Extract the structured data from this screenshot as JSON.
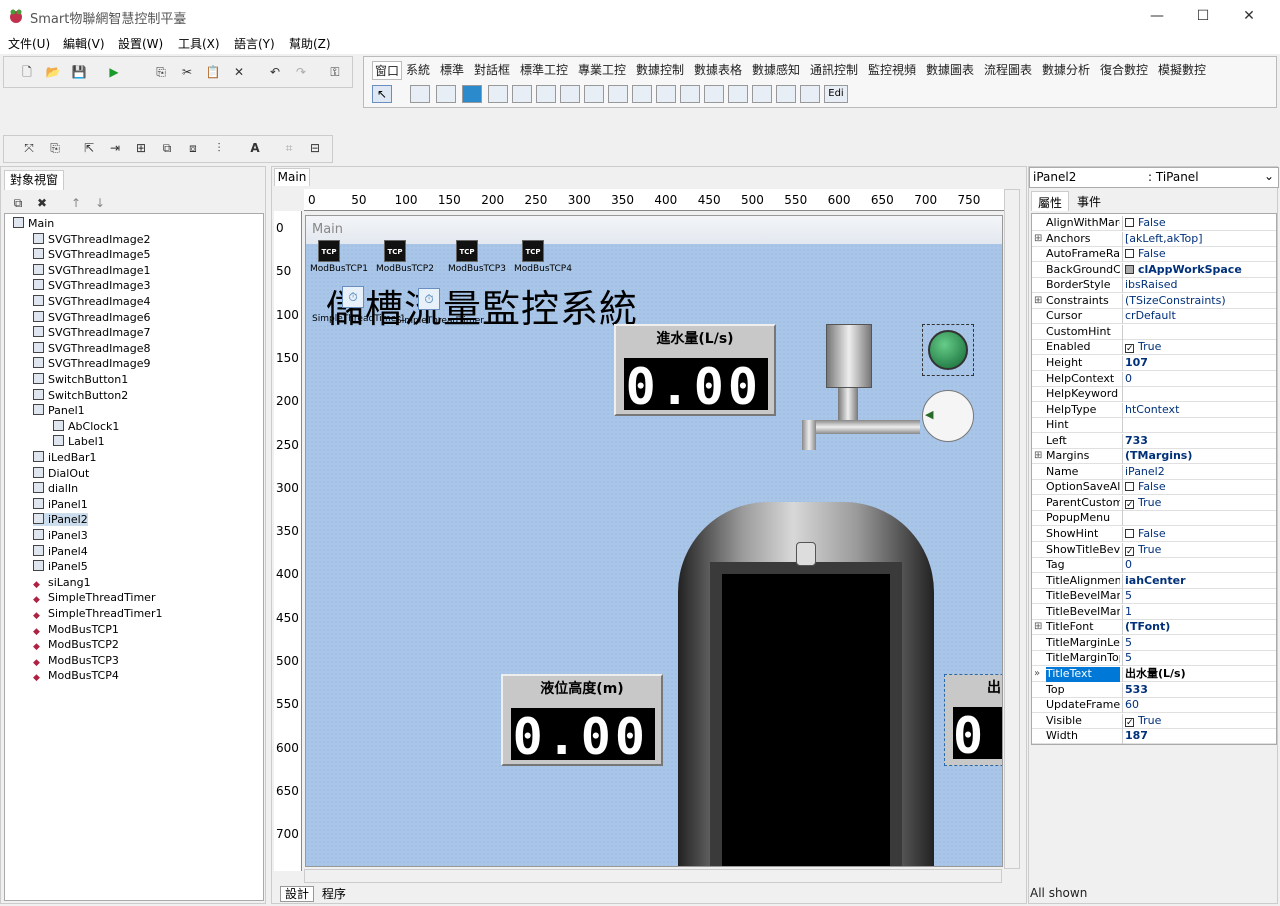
{
  "window": {
    "title": "Smart物聯網智慧控制平臺",
    "min": "—",
    "max": "☐",
    "close": "✕"
  },
  "menu": [
    "文件(U)",
    "編輯(V)",
    "設置(W)",
    "工具(X)",
    "語言(Y)",
    "幫助(Z)"
  ],
  "palette": {
    "tabs": [
      "窗口",
      "系統",
      "標準",
      "對話框",
      "標準工控",
      "專業工控",
      "數據控制",
      "數據表格",
      "數據感知",
      "通訊控制",
      "監控視頻",
      "數據圖表",
      "流程圖表",
      "數據分析",
      "復合數控",
      "模擬數控"
    ],
    "edit_btn": "Edi"
  },
  "object_view": {
    "title": "對象視窗",
    "items": [
      {
        "label": "Main",
        "level": 0,
        "icon": "form"
      },
      {
        "label": "SVGThreadImage2",
        "level": 1,
        "icon": "comp"
      },
      {
        "label": "SVGThreadImage5",
        "level": 1,
        "icon": "comp"
      },
      {
        "label": "SVGThreadImage1",
        "level": 1,
        "icon": "comp"
      },
      {
        "label": "SVGThreadImage3",
        "level": 1,
        "icon": "comp"
      },
      {
        "label": "SVGThreadImage4",
        "level": 1,
        "icon": "comp"
      },
      {
        "label": "SVGThreadImage6",
        "level": 1,
        "icon": "comp"
      },
      {
        "label": "SVGThreadImage7",
        "level": 1,
        "icon": "comp"
      },
      {
        "label": "SVGThreadImage8",
        "level": 1,
        "icon": "comp"
      },
      {
        "label": "SVGThreadImage9",
        "level": 1,
        "icon": "comp"
      },
      {
        "label": "SwitchButton1",
        "level": 1,
        "icon": "comp"
      },
      {
        "label": "SwitchButton2",
        "level": 1,
        "icon": "comp"
      },
      {
        "label": "Panel1",
        "level": 1,
        "icon": "comp"
      },
      {
        "label": "AbClock1",
        "level": 2,
        "icon": "comp"
      },
      {
        "label": "Label1",
        "level": 2,
        "icon": "comp"
      },
      {
        "label": "iLedBar1",
        "level": 1,
        "icon": "comp"
      },
      {
        "label": "DialOut",
        "level": 1,
        "icon": "comp"
      },
      {
        "label": "dialIn",
        "level": 1,
        "icon": "comp"
      },
      {
        "label": "iPanel1",
        "level": 1,
        "icon": "comp"
      },
      {
        "label": "iPanel2",
        "level": 1,
        "icon": "comp",
        "selected": true
      },
      {
        "label": "iPanel3",
        "level": 1,
        "icon": "comp"
      },
      {
        "label": "iPanel4",
        "level": 1,
        "icon": "comp"
      },
      {
        "label": "iPanel5",
        "level": 1,
        "icon": "comp"
      },
      {
        "label": "siLang1",
        "level": 1,
        "icon": "nv"
      },
      {
        "label": "SimpleThreadTimer",
        "level": 1,
        "icon": "nv"
      },
      {
        "label": "SimpleThreadTimer1",
        "level": 1,
        "icon": "nv"
      },
      {
        "label": "ModBusTCP1",
        "level": 1,
        "icon": "nv"
      },
      {
        "label": "ModBusTCP2",
        "level": 1,
        "icon": "nv"
      },
      {
        "label": "ModBusTCP3",
        "level": 1,
        "icon": "nv"
      },
      {
        "label": "ModBusTCP4",
        "level": 1,
        "icon": "nv"
      }
    ]
  },
  "designer": {
    "tab": "Main",
    "form_caption": "Main",
    "ruler_top": [
      "0",
      "50",
      "100",
      "150",
      "200",
      "250",
      "300",
      "350",
      "400",
      "450",
      "500",
      "550",
      "600",
      "650",
      "700",
      "750"
    ],
    "ruler_left": [
      "0",
      "50",
      "100",
      "150",
      "200",
      "250",
      "300",
      "350",
      "400",
      "450",
      "500",
      "550",
      "600",
      "650",
      "700"
    ],
    "tcp_badge": "TCP",
    "tcp_labels": [
      "ModBusTCP1",
      "ModBusTCP2",
      "ModBusTCP3",
      "ModBusTCP4"
    ],
    "timer_labels": [
      "SimpleThreadTimer1",
      "SimpleThreadTimer"
    ],
    "big_title": "儲槽流量監控系統",
    "panel_in_title": "進水量(L/s)",
    "panel_in_value": "0.00",
    "panel_level_title": "液位高度(m)",
    "panel_level_value": "0.00",
    "panel_out_title": "出",
    "panel_out_value": "0",
    "bottom_tabs": [
      "設計",
      "程序"
    ]
  },
  "property_view": {
    "object_name": "iPanel2",
    "object_type": ": TiPanel",
    "tabs": [
      "屬性",
      "事件"
    ],
    "rows": [
      {
        "name": "AlignWithMarg",
        "value": "False",
        "check": "off"
      },
      {
        "name": "Anchors",
        "value": "[akLeft,akTop]",
        "expand": true
      },
      {
        "name": "AutoFrameRat",
        "value": "False",
        "check": "off"
      },
      {
        "name": "BackGroundCo",
        "value": "clAppWorkSpace",
        "bold": true,
        "swatch": true
      },
      {
        "name": "BorderStyle",
        "value": "ibsRaised"
      },
      {
        "name": "Constraints",
        "value": "(TSizeConstraints)",
        "expand": true
      },
      {
        "name": "Cursor",
        "value": "crDefault"
      },
      {
        "name": "CustomHint",
        "value": ""
      },
      {
        "name": "Enabled",
        "value": "True",
        "check": "on"
      },
      {
        "name": "Height",
        "value": "107",
        "bold": true
      },
      {
        "name": "HelpContext",
        "value": "0"
      },
      {
        "name": "HelpKeyword",
        "value": ""
      },
      {
        "name": "HelpType",
        "value": "htContext"
      },
      {
        "name": "Hint",
        "value": ""
      },
      {
        "name": "Left",
        "value": "733",
        "bold": true
      },
      {
        "name": "Margins",
        "value": "(TMargins)",
        "bold": true,
        "expand": true
      },
      {
        "name": "Name",
        "value": "iPanel2"
      },
      {
        "name": "OptionSaveAllI",
        "value": "False",
        "check": "off"
      },
      {
        "name": "ParentCustomH",
        "value": "True",
        "check": "on"
      },
      {
        "name": "PopupMenu",
        "value": ""
      },
      {
        "name": "ShowHint",
        "value": "False",
        "check": "off"
      },
      {
        "name": "ShowTitleBeve",
        "value": "True",
        "check": "on"
      },
      {
        "name": "Tag",
        "value": "0"
      },
      {
        "name": "TitleAlignment",
        "value": "iahCenter",
        "bold": true
      },
      {
        "name": "TitleBevelMarg",
        "value": "5"
      },
      {
        "name": "TitleBevelMarg",
        "value": "1"
      },
      {
        "name": "TitleFont",
        "value": "(TFont)",
        "bold": true,
        "expand": true
      },
      {
        "name": "TitleMarginLeft",
        "value": "5"
      },
      {
        "name": "TitleMarginTop",
        "value": "5"
      },
      {
        "name": "TitleText",
        "value": "出水量(L/s)",
        "selected": true
      },
      {
        "name": "Top",
        "value": "533",
        "bold": true
      },
      {
        "name": "UpdateFrameR",
        "value": "60"
      },
      {
        "name": "Visible",
        "value": "True",
        "check": "on"
      },
      {
        "name": "Width",
        "value": "187",
        "bold": true
      }
    ],
    "status": "All shown"
  }
}
